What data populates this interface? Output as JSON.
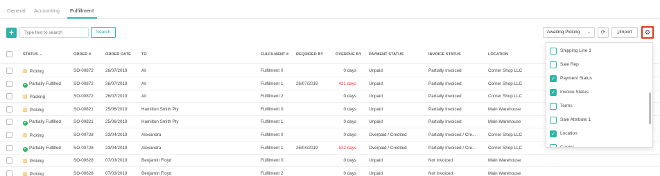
{
  "tabs": [
    {
      "label": "General"
    },
    {
      "label": "Accounting"
    },
    {
      "label": "Fulfillment"
    }
  ],
  "toolbar": {
    "add_label": "+",
    "search_placeholder": "Type text to search",
    "search_button": "Search",
    "status_filter": "Awaiting Picking",
    "import_label": "Import"
  },
  "columns": {
    "status": "STATUS",
    "order": "ORDER #",
    "order_date": "ORDER DATE",
    "to": "TO",
    "fulfilment": "FULFILMENT #",
    "required_by": "REQUIRED BY",
    "overdue_by": "OVERDUE BY",
    "payment_status": "PAYMENT STATUS",
    "invoice_status": "INVOICE STATUS",
    "location": "LOCATION"
  },
  "rows": [
    {
      "status": "Picking",
      "status_type": "picking",
      "order": "SO-00872",
      "date": "26/07/2019",
      "to": "Ali",
      "fulfilment": "Fulfilment 0",
      "required": "",
      "overdue": "0 days",
      "overdue_red": false,
      "payment": "Unpaid",
      "invoice": "Partially Invoiced",
      "location": "Corner Shop LLC"
    },
    {
      "status": "Partially Fulfilled",
      "status_type": "partial",
      "order": "SO-00872",
      "date": "26/07/2019",
      "to": "Ali",
      "fulfilment": "Fulfilment 1",
      "required": "26/07/2019",
      "overdue": "431 days",
      "overdue_red": true,
      "payment": "Unpaid",
      "invoice": "Partially Invoiced",
      "location": "Corner Shop LLC"
    },
    {
      "status": "Packing",
      "status_type": "packing",
      "order": "SO-00872",
      "date": "26/07/2019",
      "to": "Ali",
      "fulfilment": "Fulfilment 2",
      "required": "",
      "overdue": "0 days",
      "overdue_red": false,
      "payment": "Unpaid",
      "invoice": "Partially Invoiced",
      "location": "Corner Shop LLC"
    },
    {
      "status": "Picking",
      "status_type": "picking",
      "order": "SO-00821",
      "date": "25/06/2019",
      "to": "Hamilton Smith Pty",
      "fulfilment": "Fulfilment 0",
      "required": "",
      "overdue": "0 days",
      "overdue_red": false,
      "payment": "Unpaid",
      "invoice": "Partially Invoiced",
      "location": "Main Warehouse"
    },
    {
      "status": "Partially Fulfilled",
      "status_type": "partial",
      "order": "SO-00821",
      "date": "25/06/2019",
      "to": "Hamilton Smith Pty",
      "fulfilment": "Fulfilment 1",
      "required": "",
      "overdue": "0 days",
      "overdue_red": false,
      "payment": "Unpaid",
      "invoice": "Partially Invoiced",
      "location": "Main Warehouse"
    },
    {
      "status": "Picking",
      "status_type": "picking",
      "order": "SO-00728",
      "date": "23/04/2019",
      "to": "Alexandra",
      "fulfilment": "Fulfilment 0",
      "required": "",
      "overdue": "0 days",
      "overdue_red": false,
      "payment": "Overpaid / Credited",
      "invoice": "Partially Invoiced / Cre...",
      "location": "Corner Shop LLC"
    },
    {
      "status": "Partially Fulfilled",
      "status_type": "partial",
      "order": "SO-00728",
      "date": "23/04/2019",
      "to": "Alexandra",
      "fulfilment": "Fulfilment 1",
      "required": "26/04/2019",
      "overdue": "522 days",
      "overdue_red": true,
      "payment": "Overpaid / Credited",
      "invoice": "Partially Invoiced / Cre...",
      "location": "Corner Shop LLC"
    },
    {
      "status": "Picking",
      "status_type": "picking",
      "order": "SO-00628",
      "date": "07/03/2019",
      "to": "Benjamin Floyd",
      "fulfilment": "Fulfilment 0",
      "required": "",
      "overdue": "0 days",
      "overdue_red": false,
      "payment": "Unpaid",
      "invoice": "Not Invoiced",
      "location": "Main Warehouse"
    },
    {
      "status": "Picking",
      "status_type": "picking",
      "order": "SO-00628",
      "date": "07/03/2019",
      "to": "Benjamin Floyd",
      "fulfilment": "Fulfilment 2",
      "required": "",
      "overdue": "0 days",
      "overdue_red": false,
      "payment": "Unpaid",
      "invoice": "Not Invoiced",
      "location": "Main Warehouse"
    }
  ],
  "column_menu": [
    {
      "label": "Shipping Line 1",
      "checked": false
    },
    {
      "label": "Sale Rep",
      "checked": false
    },
    {
      "label": "Payment Status",
      "checked": true
    },
    {
      "label": "Invoice Status",
      "checked": true
    },
    {
      "label": "Terms",
      "checked": false
    },
    {
      "label": "Sale Attribute 1",
      "checked": false
    },
    {
      "label": "Location",
      "checked": true
    },
    {
      "label": "Carrier",
      "checked": false
    }
  ],
  "colors": {
    "accent": "#2bb5a8",
    "highlight": "#e8321f",
    "overdue": "#e53935"
  }
}
